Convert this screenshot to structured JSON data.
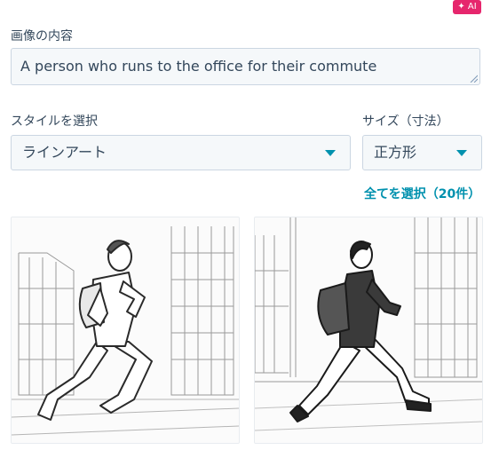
{
  "ai_badge": "✦ AI",
  "description": {
    "label": "画像の内容",
    "value": "A person who runs to the office for their commute"
  },
  "style_select": {
    "label": "スタイルを選択",
    "value": "ラインアート"
  },
  "size_select": {
    "label": "サイズ（寸法）",
    "value": "正方形"
  },
  "select_all": "全てを選択（20件）",
  "colors": {
    "accent": "#0091ae",
    "ai_badge": "#e6266d",
    "text": "#33475b"
  },
  "images": [
    {
      "subject": "man running with backpack, line art"
    },
    {
      "subject": "woman walking with backpack, line art"
    }
  ]
}
